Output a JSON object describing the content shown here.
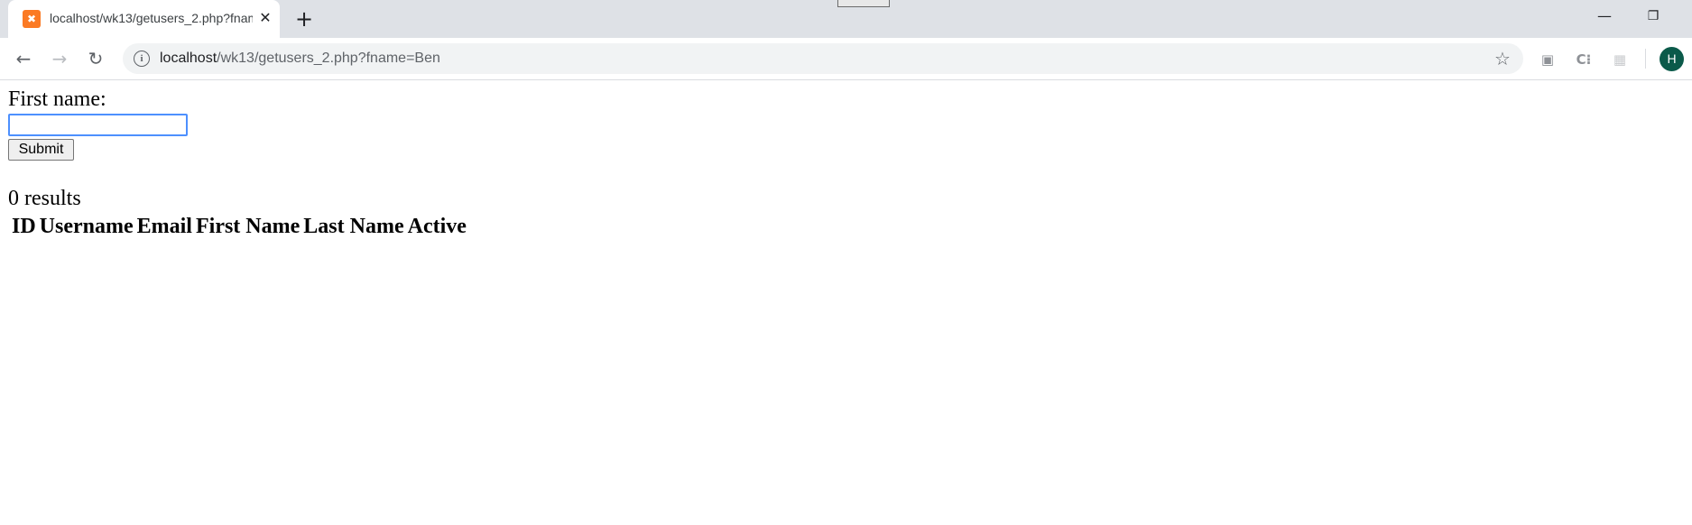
{
  "browser": {
    "tab": {
      "title": "localhost/wk13/getusers_2.php?fname=Ben",
      "favicon_glyph": "✖",
      "close_glyph": "✕"
    },
    "new_tab_glyph": "+",
    "window_minimize_glyph": "—",
    "window_restore_glyph": "❐",
    "nav": {
      "back_glyph": "←",
      "forward_glyph": "→",
      "reload_glyph": "↻"
    },
    "omnibox": {
      "info_glyph": "i",
      "url_host": "localhost",
      "url_rest": "/wk13/getusers_2.php?fname=Ben",
      "star_glyph": "☆"
    },
    "extensions": [
      {
        "name": "bag-extension-icon",
        "glyph": "▣"
      },
      {
        "name": "c-extension-icon",
        "glyph": "C⁝"
      },
      {
        "name": "grid-extension-icon",
        "glyph": "▦"
      }
    ],
    "avatar_letter": "H",
    "colors": {
      "tab_strip": "#dee1e6",
      "omnibox": "#f1f3f4",
      "avatar": "#0b5a4a",
      "favicon": "#fb7a24",
      "input_focus": "#4d90fe"
    }
  },
  "form": {
    "label": "First name:",
    "input_value": "",
    "submit_label": "Submit"
  },
  "results": {
    "summary": "0 results",
    "columns": [
      "ID",
      "Username",
      "Email",
      "First Name",
      "Last Name",
      "Active"
    ]
  }
}
